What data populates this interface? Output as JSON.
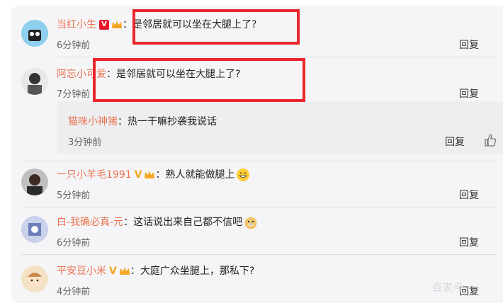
{
  "comments": [
    {
      "username": "当红小生",
      "comment": "是邻居就可以坐在大腿上了?",
      "time": "6分钟前",
      "reply": "回复"
    },
    {
      "username": "阿忘小可爱",
      "comment": "是邻居就可以坐在大腿上了?",
      "time": "7分钟前",
      "reply": "回复"
    },
    {
      "username": "一只小羊毛1991",
      "comment": "熟人就能做腿上",
      "time": "5分钟前",
      "reply": "回复"
    },
    {
      "username": "白-我确必真-元",
      "comment": "这话说出来自己都不信吧",
      "time": "6分钟前",
      "reply": "回复"
    },
    {
      "username": "平安豆小米",
      "comment": "大庭广众坐腿上，那私下?",
      "time": "4分钟前",
      "reply": "回复"
    }
  ],
  "subreply": {
    "username": "猫咪小神猪",
    "comment": "热一干嘛抄袭我说话",
    "time": "3分钟前",
    "reply": "回复"
  },
  "colors": {
    "username": "#eb7350",
    "highlight": "#e8262b",
    "panel": "#f5f5f7"
  },
  "icons": {
    "like": "thumb-up-icon",
    "verified": "v-badge-icon",
    "member": "crown-icon"
  },
  "watermark": "百家号"
}
